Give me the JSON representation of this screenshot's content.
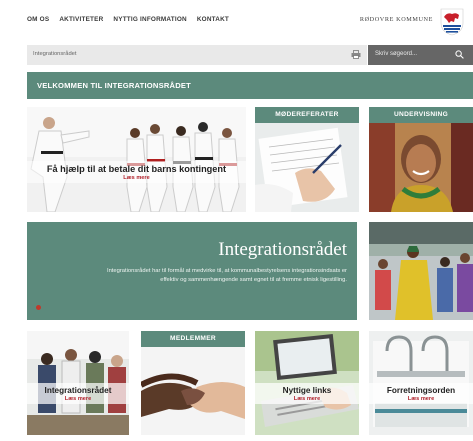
{
  "nav": {
    "items": [
      {
        "label": "OM OS"
      },
      {
        "label": "AKTIVITETER"
      },
      {
        "label": "NYTTIG INFORMATION"
      },
      {
        "label": "KONTAKT"
      }
    ],
    "brand": "RØDOVRE KOMMUNE",
    "logo_icon": "rodovre-coat-of-arms-icon"
  },
  "breadcrumb": "Integrationsrådet",
  "search": {
    "placeholder": "Skriv søgeord..."
  },
  "welcome": "VELKOMMEN TIL INTEGRATIONSRÅDET",
  "tiles": {
    "kontingent": {
      "title": "Få hjælp til at betale dit barns kontingent",
      "more": "Læs mere"
    },
    "moedereferater": {
      "header": "MØDEREFERATER"
    },
    "undervisning": {
      "header": "UNDERVISNING"
    },
    "medlemmer": {
      "header": "MEDLEMMER"
    },
    "integrationsraadet": {
      "title": "Integrationsrådet",
      "more": "Læs mere"
    },
    "nyttige_links": {
      "title": "Nyttige links",
      "more": "Læs mere"
    },
    "forretningsorden": {
      "title": "Forretningsorden",
      "more": "Læs mere"
    }
  },
  "hero": {
    "title": "Integrationsrådet",
    "text": "Integrationsrådet har til formål at medvirke til, at kommunalbestyrelsens integrationsindsats er effektiv og sammenhængende samt egnet til at fremme etnisk ligestilling."
  },
  "colors": {
    "accent": "#5c8a7c",
    "link": "#b0202a",
    "search_bg": "#666666"
  }
}
